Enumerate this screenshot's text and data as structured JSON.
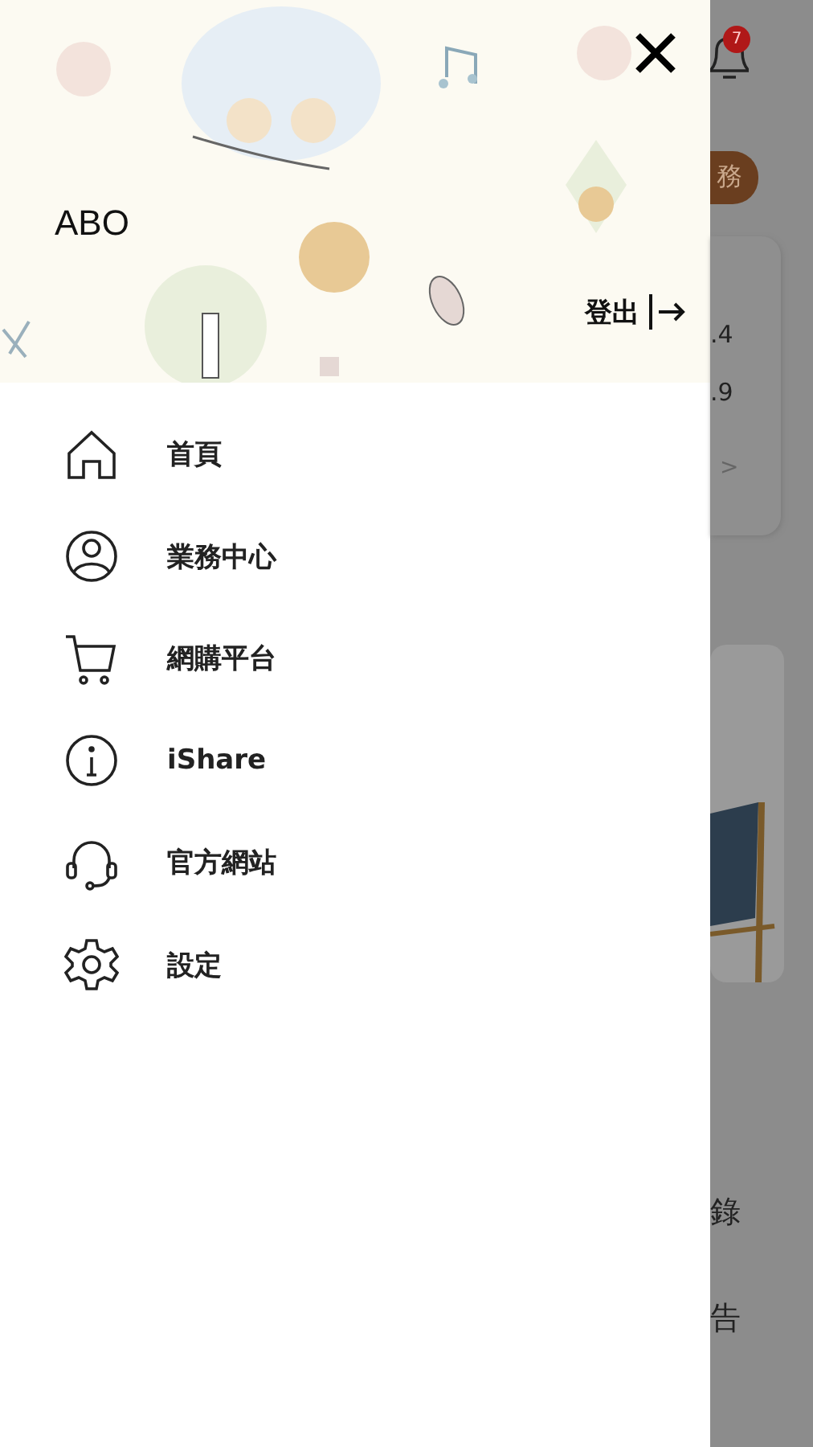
{
  "drawer": {
    "user_name": "ABO",
    "logout": "登出",
    "menu": [
      {
        "kind": "home",
        "label": "首頁"
      },
      {
        "kind": "person",
        "label": "業務中心"
      },
      {
        "kind": "cart",
        "label": "網購平台"
      },
      {
        "kind": "info",
        "label": "iShare"
      },
      {
        "kind": "headset",
        "label": "官方網站"
      },
      {
        "kind": "gear",
        "label": "設定"
      }
    ]
  },
  "background_page": {
    "notification_count": "7",
    "task_pill": "務",
    "stats": [
      ".4",
      ".9"
    ],
    "more": ">",
    "bottom_items": [
      "錄",
      "告"
    ]
  }
}
